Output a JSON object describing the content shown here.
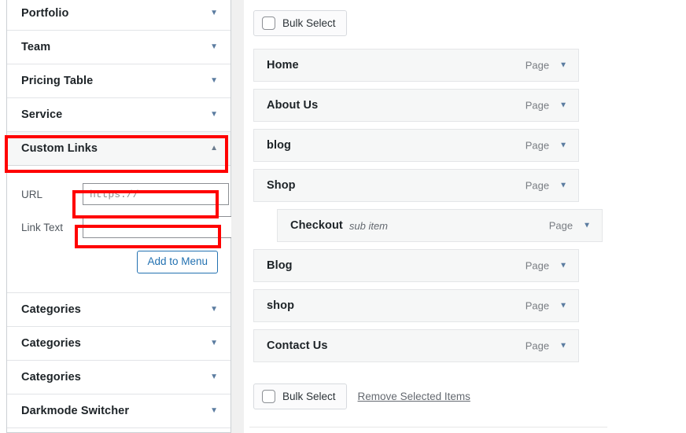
{
  "sidebar": {
    "items": [
      {
        "label": "Portfolio",
        "state": "collapsed",
        "caret": "chevron-down-icon"
      },
      {
        "label": "Team",
        "state": "collapsed",
        "caret": "chevron-down-icon"
      },
      {
        "label": "Pricing Table",
        "state": "collapsed",
        "caret": "chevron-down-icon"
      },
      {
        "label": "Service",
        "state": "collapsed",
        "caret": "chevron-down-icon"
      },
      {
        "label": "Custom Links",
        "state": "expanded",
        "caret": "chevron-up-icon",
        "highlighted": true
      },
      {
        "label": "Categories",
        "state": "collapsed",
        "caret": "chevron-down-icon"
      },
      {
        "label": "Categories",
        "state": "collapsed",
        "caret": "chevron-down-icon"
      },
      {
        "label": "Categories",
        "state": "collapsed",
        "caret": "chevron-down-icon"
      },
      {
        "label": "Darkmode Switcher",
        "state": "collapsed",
        "caret": "chevron-down-icon"
      }
    ],
    "caret_down_glyph": "▼",
    "caret_up_glyph": "▲"
  },
  "custom_links_form": {
    "url": {
      "label": "URL",
      "value": "",
      "placeholder": "https://",
      "highlighted": true
    },
    "link_text": {
      "label": "Link Text",
      "value": "",
      "placeholder": "",
      "highlighted": true
    },
    "add_button_label": "Add to Menu"
  },
  "menu_structure": {
    "bulk_select_top_label": "Bulk Select",
    "bulk_select_bottom_label": "Bulk Select",
    "remove_selected_label": "Remove Selected Items",
    "items": [
      {
        "title": "Home",
        "type": "Page",
        "sub": false,
        "subtag": ""
      },
      {
        "title": "About Us",
        "type": "Page",
        "sub": false,
        "subtag": ""
      },
      {
        "title": "blog",
        "type": "Page",
        "sub": false,
        "subtag": ""
      },
      {
        "title": "Shop",
        "type": "Page",
        "sub": false,
        "subtag": ""
      },
      {
        "title": "Checkout",
        "type": "Page",
        "sub": true,
        "subtag": "sub item"
      },
      {
        "title": "Blog",
        "type": "Page",
        "sub": false,
        "subtag": ""
      },
      {
        "title": "shop",
        "type": "Page",
        "sub": false,
        "subtag": ""
      },
      {
        "title": "Contact Us",
        "type": "Page",
        "sub": false,
        "subtag": ""
      }
    ],
    "caret_glyph": "▼"
  },
  "colors": {
    "highlight": "#ff0000",
    "accent_blue": "#2271b1",
    "row_bg": "#f6f7f7",
    "caret_blue": "#5b7ca0",
    "text_dark": "#1d2327",
    "text_muted": "#787c82"
  }
}
